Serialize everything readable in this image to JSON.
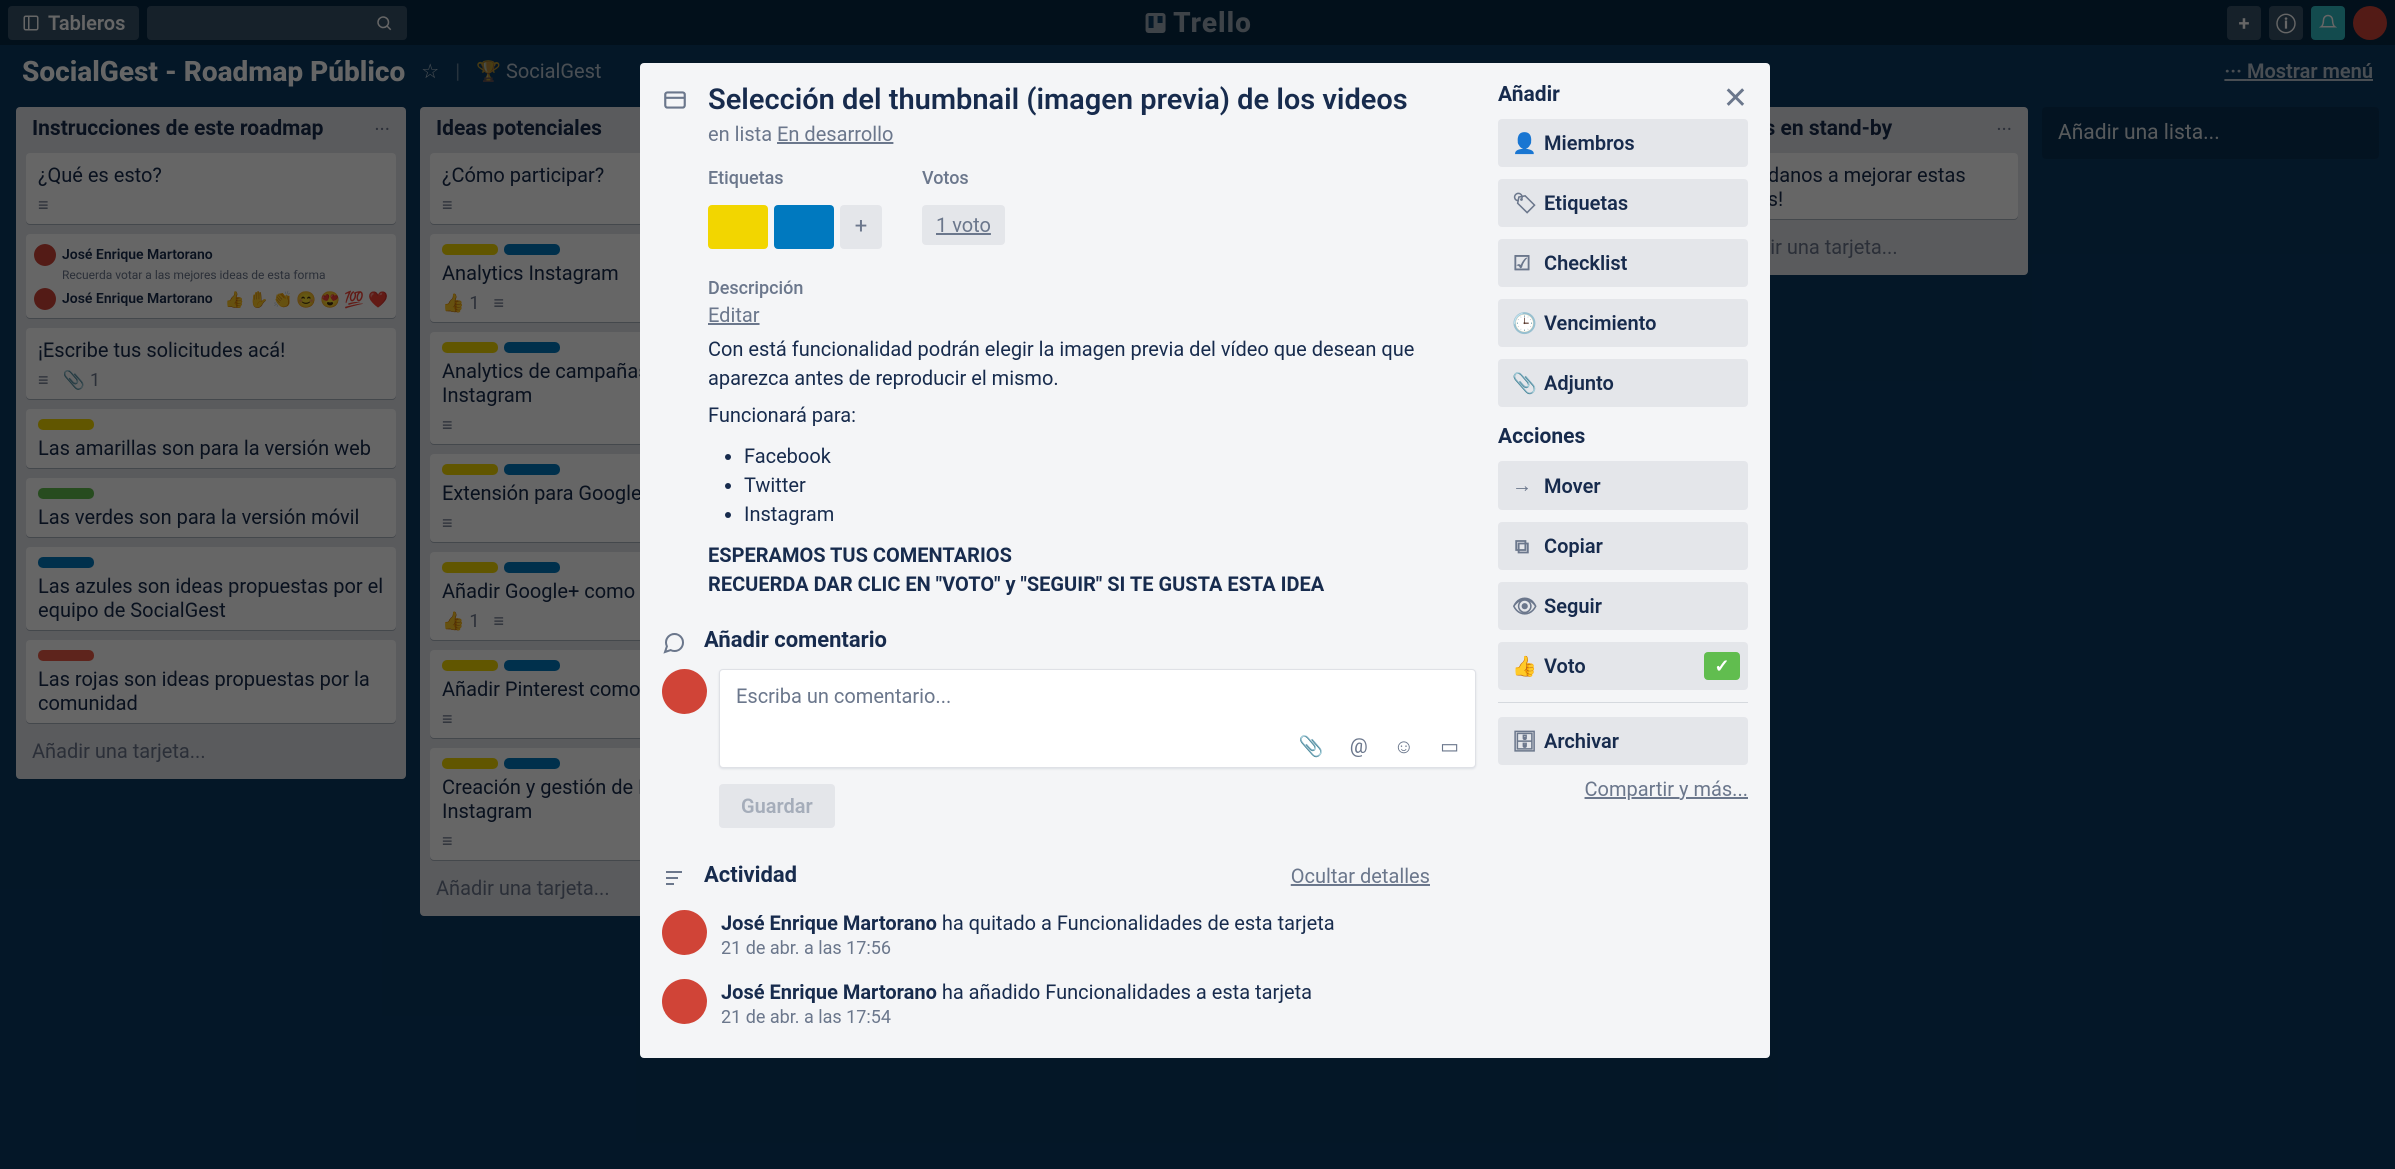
{
  "topbar": {
    "boards_label": "Tableros"
  },
  "logo_text": "Trello",
  "board": {
    "name": "SocialGest - Roadmap Público",
    "team": "SocialGest",
    "menu_label": "Mostrar menú"
  },
  "lists": [
    {
      "title": "Instrucciones de este roadmap",
      "cards": [
        {
          "text": "¿Qué es esto?"
        },
        {
          "text_line1": "José Enrique Martorano",
          "text_line2": "Recuerda votar a las mejores ideas de esta forma",
          "img": true
        },
        {
          "text": "¡Escribe tus solicitudes acá!",
          "attach": "1"
        },
        {
          "labels": [
            "yellow"
          ],
          "text": "Las amarillas son para la versión web"
        },
        {
          "labels": [
            "green"
          ],
          "text": "Las verdes son para la versión móvil"
        },
        {
          "labels": [
            "blue"
          ],
          "text": "Las azules son ideas propuestas por el equipo de SocialGest"
        },
        {
          "labels": [
            "red"
          ],
          "text": "Las rojas son ideas propuestas por la comunidad"
        }
      ],
      "add": "Añadir una tarjeta..."
    },
    {
      "title": "Ideas potenciales",
      "cards": [
        {
          "text": "¿Cómo participar?"
        },
        {
          "labels": [
            "yellow",
            "blue"
          ],
          "text": "Analytics Instagram",
          "votes": "1"
        },
        {
          "labels": [
            "yellow",
            "blue"
          ],
          "text": "Analytics de campañas Facebook - Instagram"
        },
        {
          "labels": [
            "yellow",
            "blue"
          ],
          "text": "Extensión para Google Chrome"
        },
        {
          "labels": [
            "yellow",
            "blue"
          ],
          "text": "Añadir Google+ como red social",
          "votes": "1"
        },
        {
          "labels": [
            "yellow",
            "blue"
          ],
          "text": "Añadir Pinterest como red social"
        },
        {
          "labels": [
            "yellow",
            "blue"
          ],
          "text": "Creación y gestión de Facebook, Instagram"
        }
      ],
      "add": "Añadir una tarjeta..."
    },
    {
      "title": "Ideas en stand-by",
      "cards": [
        {
          "text": "¡Ayudanos a mejorar estas ideas!"
        }
      ],
      "add": "Añadir una tarjeta..."
    }
  ],
  "add_list": "Añadir una lista...",
  "modal": {
    "title": "Selección del thumbnail (imagen previa) de los videos",
    "inlist_prefix": "en lista ",
    "inlist_link": "En desarrollo",
    "labels_h": "Etiquetas",
    "votes_h": "Votos",
    "vote_count": "1 voto",
    "desc_h": "Descripción",
    "edit": "Editar",
    "desc_p1": "Con está funcionalidad podrán elegir la imagen previa del vídeo que desean que aparezca antes de reproducir el mismo.",
    "desc_p2": "Funcionará para:",
    "desc_li1": "Facebook",
    "desc_li2": "Twitter",
    "desc_li3": "Instagram",
    "desc_b1": "ESPERAMOS TUS COMENTARIOS",
    "desc_b2": "RECUERDA DAR CLIC EN \"VOTO\" y \"SEGUIR\" SI TE GUSTA ESTA IDEA",
    "comment_h": "Añadir comentario",
    "comment_placeholder": "Escriba un comentario...",
    "save": "Guardar",
    "activity_h": "Actividad",
    "hide_details": "Ocultar detalles",
    "acts": [
      {
        "who": "José Enrique Martorano",
        "what": " ha quitado a Funcionalidades de esta tarjeta",
        "when": "21 de abr. a las 17:56"
      },
      {
        "who": "José Enrique Martorano",
        "what": " ha añadido Funcionalidades a esta tarjeta",
        "when": "21 de abr. a las 17:54"
      }
    ],
    "side": {
      "add_h": "Añadir",
      "members": "Miembros",
      "labels": "Etiquetas",
      "checklist": "Checklist",
      "due": "Vencimiento",
      "attachment": "Adjunto",
      "actions_h": "Acciones",
      "move": "Mover",
      "copy": "Copiar",
      "follow": "Seguir",
      "vote": "Voto",
      "archive": "Archivar",
      "share": "Compartir y más..."
    }
  }
}
